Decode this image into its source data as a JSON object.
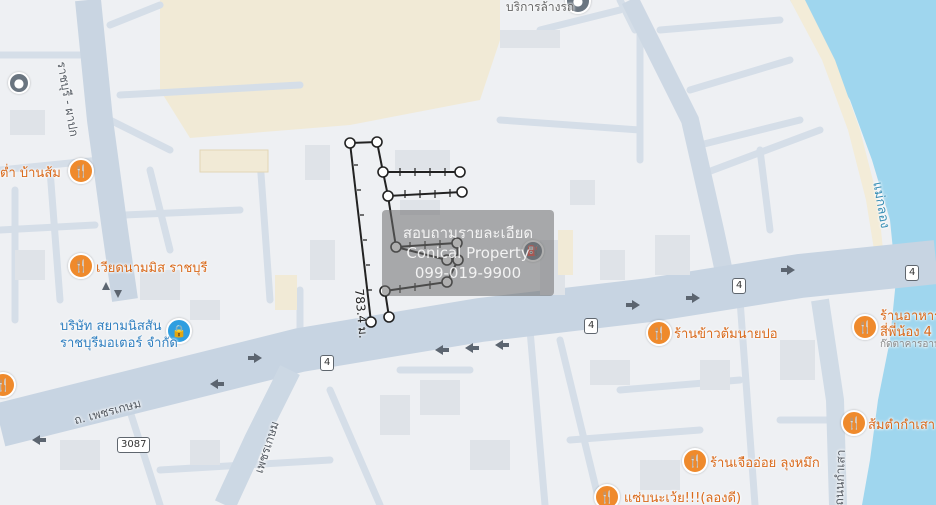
{
  "map": {
    "colors": {
      "land": "#eef0f3",
      "sand": "#f1ead6",
      "water": "#9fd6ee",
      "highway": "#c7d4e2",
      "road": "#d5dee8",
      "poi": "#ef8a2c",
      "shop": "#2f9ee0"
    },
    "labels": {
      "car_wash": "บริการล้างรถ",
      "road_ratchaburi": "ราชบุรี - ผาปก",
      "poi_baansom": "ต่ำ บ้านส้ม",
      "poi_wiangnam": "เวียดนามมิส ราชบุรี",
      "poi_khaotom": "ร้านข้าวต้มนายปอ",
      "poi_raan_aahaan": "ร้านอาหาร",
      "poi_sipinong": "สี่พี่น้อง 4",
      "poi_sipinong_sub": "ก๊ดตาคารอาห",
      "poi_somtam": "ส้มตำกำเสา",
      "poi_jeuoi": "ร้านเจืออ่อย ลุงหมึก",
      "poi_zaab": "แซ่บนะเว้ย!!!(ลองดี)",
      "company_line1": "บริษัท สยามนิสสัน",
      "company_line2": "ราชบุรีมอเตอร์ จำกัด",
      "road_phetkasem": "ถ. เพชรเกษม",
      "road_phetkasem_v": "เพชรเกษม",
      "road_kamsao": "ถนนกำเสา",
      "river": "แม่กลอง",
      "measure": "783.4 ม."
    },
    "shields": [
      "4",
      "4",
      "4",
      "4",
      "3087"
    ],
    "watermark": {
      "line1": "สอบถามรายละเอียด",
      "line2": "Conical Property",
      "line3": "099-019-9900"
    },
    "icons": [
      "food-icon",
      "shop-icon",
      "gas-station-icon",
      "place-icon"
    ]
  }
}
